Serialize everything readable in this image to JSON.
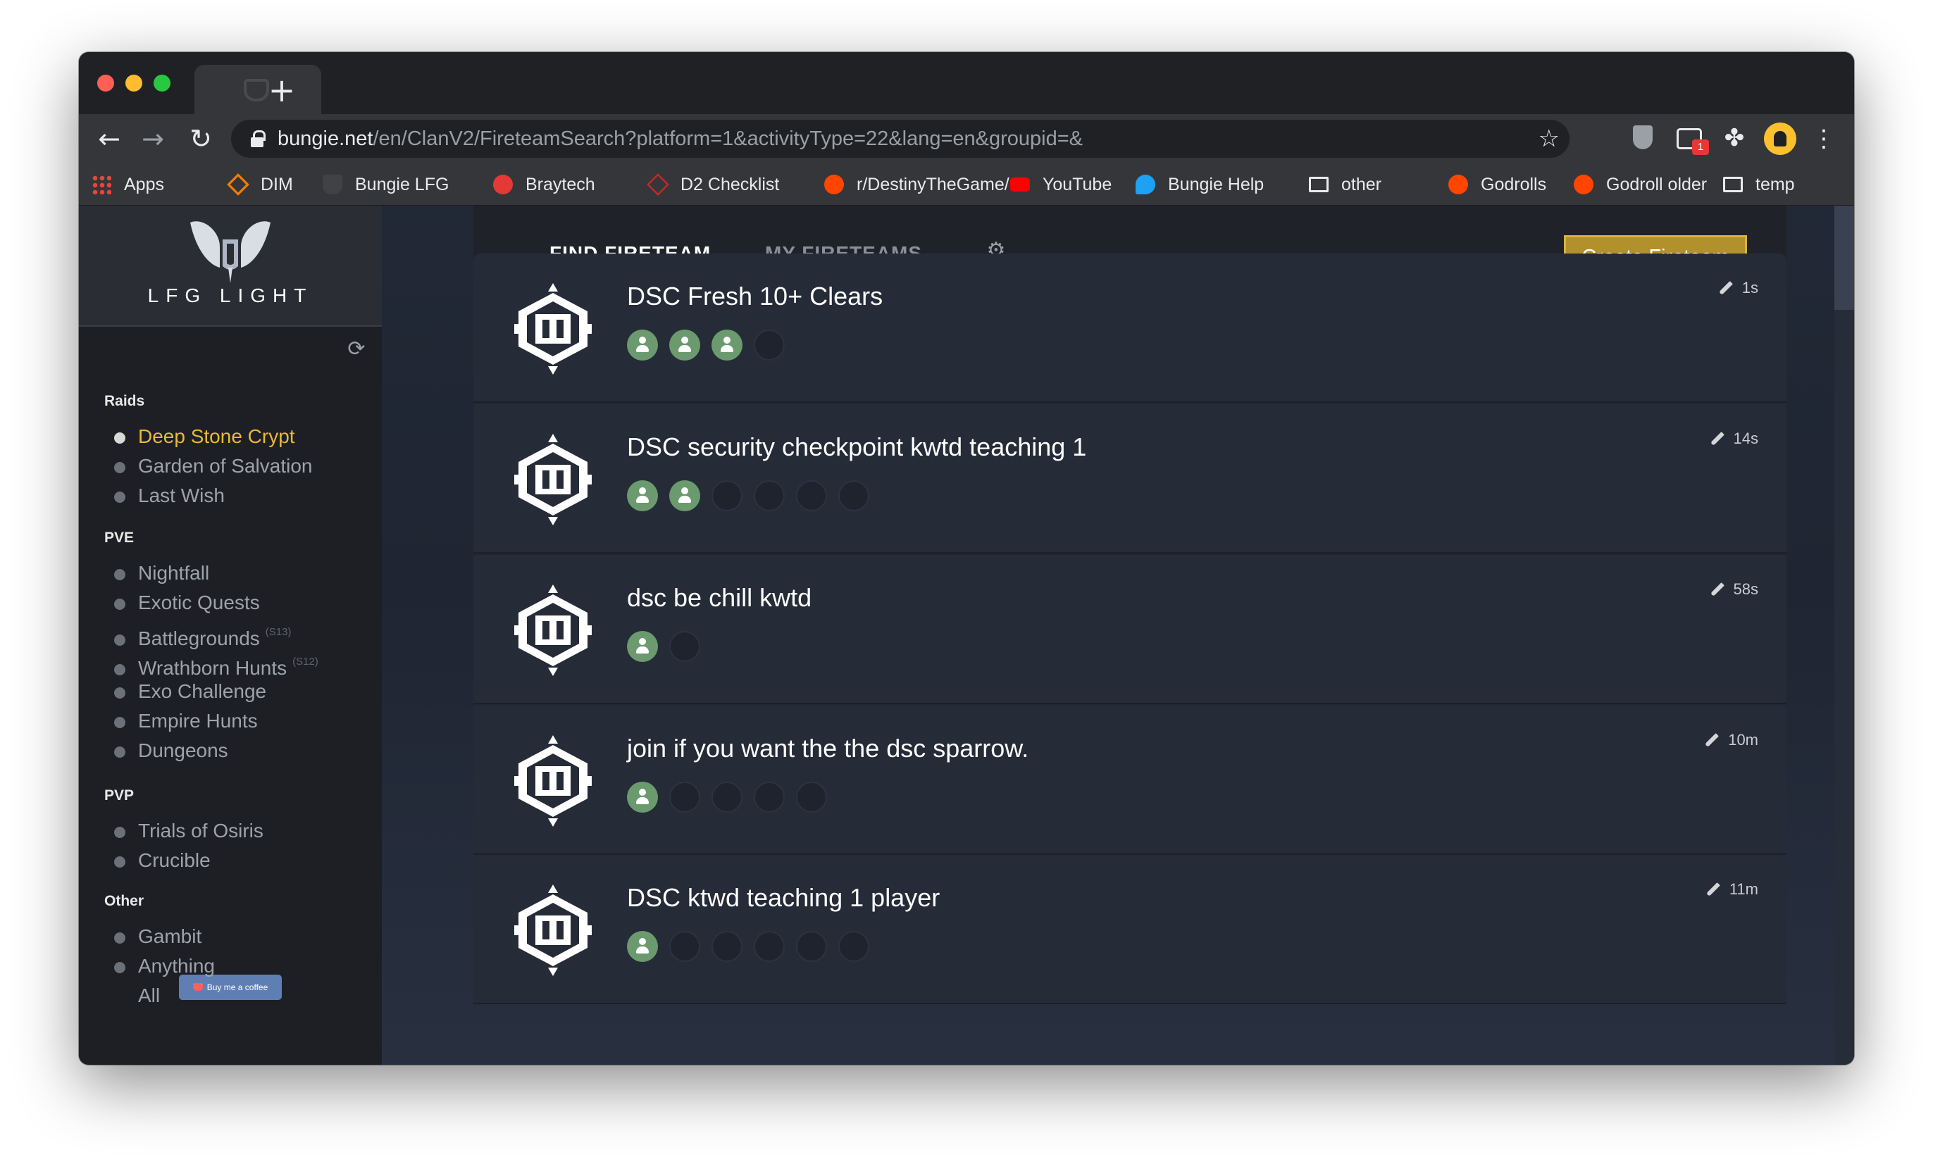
{
  "browser": {
    "url_host": "bungie.net",
    "url_path": "/en/ClanV2/FireteamSearch?platform=1&activityType=22&lang=en&groupid=&",
    "extension_badge": "1",
    "bookmarks": [
      {
        "label": "Apps",
        "icon": "apps-grid-icon"
      },
      {
        "label": "DIM",
        "icon": "dim-logo-icon"
      },
      {
        "label": "Bungie LFG",
        "icon": "bungie-shield-icon"
      },
      {
        "label": "Braytech",
        "icon": "braytech-icon"
      },
      {
        "label": "D2 Checklist",
        "icon": "d2-checklist-icon"
      },
      {
        "label": "r/DestinyTheGame/",
        "icon": "reddit-icon"
      },
      {
        "label": "YouTube",
        "icon": "youtube-icon"
      },
      {
        "label": "Bungie Help",
        "icon": "twitter-icon"
      },
      {
        "label": "other",
        "icon": "folder-icon"
      },
      {
        "label": "Godrolls",
        "icon": "reddit-icon"
      },
      {
        "label": "Godroll older",
        "icon": "reddit-icon"
      },
      {
        "label": "temp",
        "icon": "folder-icon"
      }
    ]
  },
  "sidebar": {
    "logo_text": "LFG LIGHT",
    "sections": [
      {
        "title": "Raids",
        "items": [
          {
            "label": "Deep Stone Crypt",
            "active": true
          },
          {
            "label": "Garden of Salvation"
          },
          {
            "label": "Last Wish"
          }
        ]
      },
      {
        "title": "PVE",
        "items": [
          {
            "label": "Nightfall"
          },
          {
            "label": "Exotic Quests"
          },
          {
            "label": "Battlegrounds",
            "sup": "(S13)"
          },
          {
            "label": "Wrathborn Hunts",
            "sup": "(S12)"
          },
          {
            "label": "Exo Challenge"
          },
          {
            "label": "Empire Hunts"
          },
          {
            "label": "Dungeons"
          }
        ]
      },
      {
        "title": "PVP",
        "items": [
          {
            "label": "Trials of Osiris"
          },
          {
            "label": "Crucible"
          }
        ]
      },
      {
        "title": "Other",
        "items": [
          {
            "label": "Gambit"
          },
          {
            "label": "Anything"
          },
          {
            "label": "All",
            "no_icon": true
          }
        ]
      }
    ],
    "coffee_label": "Buy me a coffee"
  },
  "tabs": {
    "find": "FIND FIRETEAM",
    "mine": "MY FIRETEAMS"
  },
  "create_button": "Create Fireteam",
  "colors": {
    "accent_gold": "#e9b93a",
    "create_button": "#b2912c",
    "slot_filled": "#6b9a6e",
    "card_bg": "#252b37"
  },
  "fireteams": [
    {
      "title": "DSC Fresh 10+ Clears",
      "time": "1s",
      "filled": 3,
      "total": 4
    },
    {
      "title": "DSC security checkpoint kwtd teaching 1",
      "time": "14s",
      "filled": 2,
      "total": 6
    },
    {
      "title": "dsc be chill kwtd",
      "time": "58s",
      "filled": 1,
      "total": 2
    },
    {
      "title": "join if you want the the dsc sparrow.",
      "time": "10m",
      "filled": 1,
      "total": 5
    },
    {
      "title": "DSC ktwd teaching 1 player",
      "time": "11m",
      "filled": 1,
      "total": 6
    }
  ]
}
